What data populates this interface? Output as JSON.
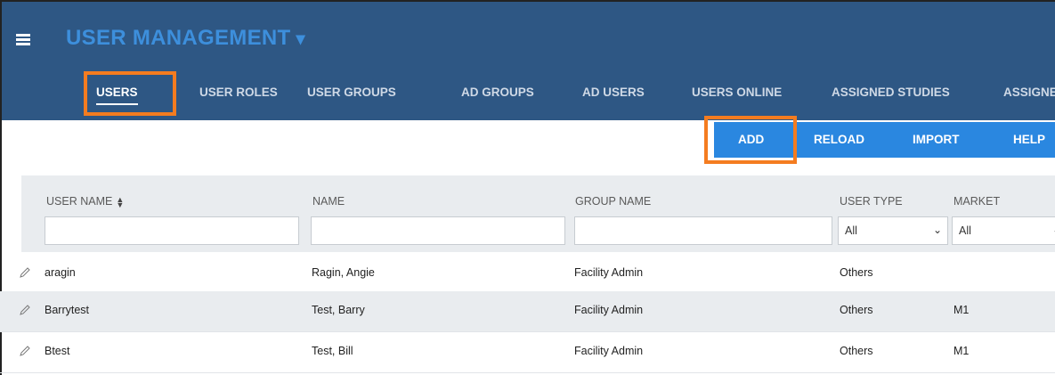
{
  "header": {
    "title": "USER MANAGEMENT",
    "title_caret": "▾",
    "menu_icon": "hamburger-menu-icon",
    "bg_color": "#2e5784",
    "title_color": "#3d8fdc"
  },
  "tabs": [
    {
      "label": "USERS",
      "active": true
    },
    {
      "label": "USER ROLES"
    },
    {
      "label": "USER GROUPS"
    },
    {
      "label": "AD GROUPS"
    },
    {
      "label": "AD USERS"
    },
    {
      "label": "USERS ONLINE"
    },
    {
      "label": "ASSIGNED STUDIES"
    },
    {
      "label": "ASSIGNE"
    }
  ],
  "actions": {
    "add": "ADD",
    "reload": "RELOAD",
    "import": "IMPORT",
    "help": "HELP",
    "color": "#2a87e0"
  },
  "highlight_color": "#f47c20",
  "table": {
    "columns": [
      "USER NAME",
      "NAME",
      "GROUP NAME",
      "USER TYPE",
      "MARKET"
    ],
    "sort_icon": "sort-both-icon",
    "filters": {
      "user_name": "",
      "name": "",
      "group_name": "",
      "user_type": "All",
      "market": "All"
    },
    "rows": [
      {
        "user_name": "aragin",
        "name": "Ragin, Angie",
        "group_name": "Facility Admin",
        "user_type": "Others",
        "market": ""
      },
      {
        "user_name": "Barrytest",
        "name": "Test, Barry",
        "group_name": "Facility Admin",
        "user_type": "Others",
        "market": "M1"
      },
      {
        "user_name": "Btest",
        "name": "Test, Bill",
        "group_name": "Facility Admin",
        "user_type": "Others",
        "market": "M1"
      }
    ]
  }
}
